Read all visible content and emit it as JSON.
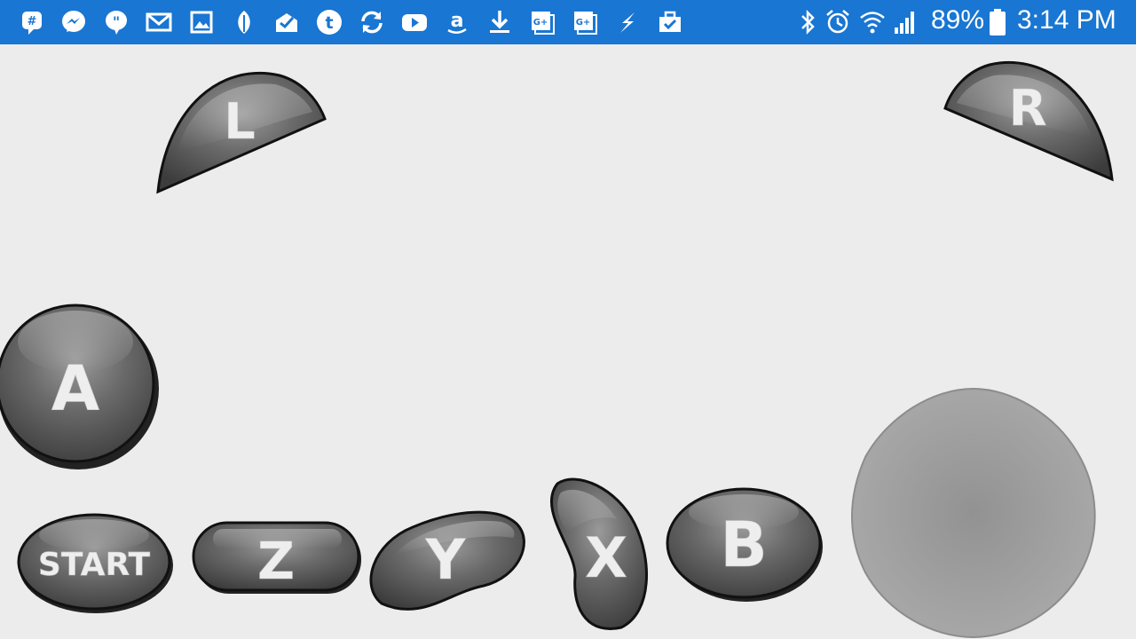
{
  "status_bar": {
    "notification_icons": [
      "hangouts-icon",
      "messenger-icon",
      "quotes-icon",
      "mail-icon",
      "gallery-icon",
      "sprout-icon",
      "inbox-icon",
      "tumblr-icon",
      "sync-icon",
      "youtube-icon",
      "amazon-icon",
      "download-icon",
      "google-plus-icon",
      "google-plus-icon",
      "lightning-icon",
      "briefcase-check-icon"
    ],
    "system_icons": [
      "bluetooth-icon",
      "alarm-icon",
      "wifi-icon",
      "signal-icon",
      "battery-icon"
    ],
    "battery_percent": "89%",
    "time": "3:14 PM",
    "bar_color": "#1976d2"
  },
  "controller": {
    "buttons": {
      "l": "L",
      "r": "R",
      "a": "A",
      "start": "START",
      "z": "Z",
      "y": "Y",
      "x": "X",
      "b": "B"
    },
    "joystick": "analog-stick"
  }
}
